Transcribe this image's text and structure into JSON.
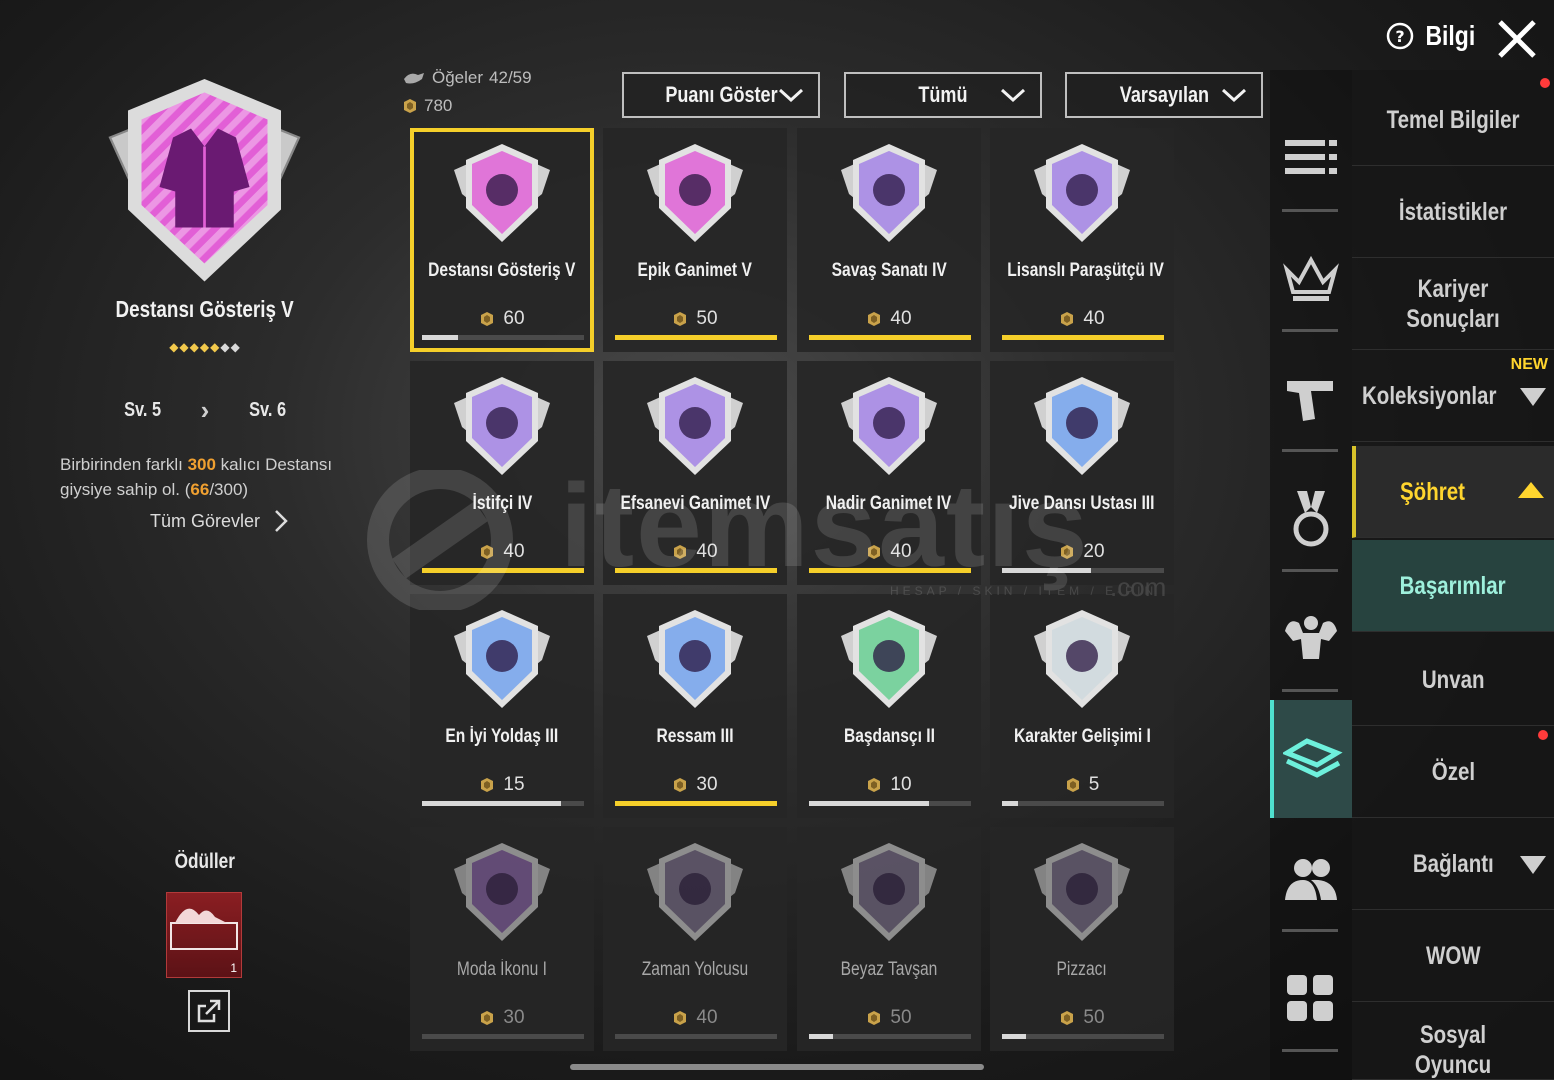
{
  "header": {
    "info_label": "Bilgi"
  },
  "selected": {
    "title": "Destansı Gösteriş V",
    "stars_filled": 5,
    "stars_total": 7,
    "level_from": "Sv. 5",
    "level_to": "Sv. 6",
    "desc_prefix": "Birbirinden farklı",
    "desc_target": "300",
    "desc_mid": "kalıcı Destansı giysiye sahip ol. (",
    "desc_progress": "66",
    "desc_suffix": "/300)",
    "all_tasks": "Tüm Görevler",
    "rewards_title": "Ödüller",
    "reward_count": "1"
  },
  "stats": {
    "items_label": "Öğeler",
    "items_value": "42/59",
    "points_value": "780"
  },
  "filters": {
    "points": "Puanı Göster",
    "category": "Tümü",
    "sort": "Varsayılan"
  },
  "achievements": [
    {
      "name": "Destansı Gösteriş V",
      "points": "60",
      "progress": 0.22,
      "color": "#d957d0",
      "selected": true,
      "locked": false,
      "complete": false
    },
    {
      "name": "Epik Ganimet V",
      "points": "50",
      "progress": 1.0,
      "color": "#d957d0",
      "selected": false,
      "locked": false,
      "complete": true
    },
    {
      "name": "Savaş Sanatı IV",
      "points": "40",
      "progress": 1.0,
      "color": "#9b7ae0",
      "selected": false,
      "locked": false,
      "complete": true
    },
    {
      "name": "Lisanslı Paraşütçü IV",
      "points": "40",
      "progress": 1.0,
      "color": "#9b7ae0",
      "selected": false,
      "locked": false,
      "complete": true
    },
    {
      "name": "İstifçi IV",
      "points": "40",
      "progress": 1.0,
      "color": "#9b7ae0",
      "selected": false,
      "locked": false,
      "complete": true
    },
    {
      "name": "Efsanevi Ganimet IV",
      "points": "40",
      "progress": 1.0,
      "color": "#9b7ae0",
      "selected": false,
      "locked": false,
      "complete": true
    },
    {
      "name": "Nadir Ganimet IV",
      "points": "40",
      "progress": 1.0,
      "color": "#9b7ae0",
      "selected": false,
      "locked": false,
      "complete": true
    },
    {
      "name": "Jive Dansı Ustası III",
      "points": "20",
      "progress": 0.55,
      "color": "#6b9be8",
      "selected": false,
      "locked": false,
      "complete": false
    },
    {
      "name": "En İyi Yoldaş III",
      "points": "15",
      "progress": 0.86,
      "color": "#6b9be8",
      "selected": false,
      "locked": false,
      "complete": false
    },
    {
      "name": "Ressam III",
      "points": "30",
      "progress": 1.0,
      "color": "#6b9be8",
      "selected": false,
      "locked": false,
      "complete": true
    },
    {
      "name": "Başdansçı II",
      "points": "10",
      "progress": 0.74,
      "color": "#5fc98a",
      "selected": false,
      "locked": false,
      "complete": false
    },
    {
      "name": "Karakter Gelişimi I",
      "points": "5",
      "progress": 0.1,
      "color": "#c9d4d8",
      "selected": false,
      "locked": false,
      "complete": false
    },
    {
      "name": "Moda İkonu I",
      "points": "30",
      "progress": 0.0,
      "color": "#7e4aa8",
      "selected": false,
      "locked": true,
      "complete": false
    },
    {
      "name": "Zaman Yolcusu",
      "points": "40",
      "progress": 0.0,
      "color": "#6b5a80",
      "selected": false,
      "locked": true,
      "complete": false
    },
    {
      "name": "Beyaz Tavşan",
      "points": "50",
      "progress": 0.15,
      "color": "#6b5a80",
      "selected": false,
      "locked": true,
      "complete": false
    },
    {
      "name": "Pizzacı",
      "points": "50",
      "progress": 0.15,
      "color": "#6b5a80",
      "selected": false,
      "locked": true,
      "complete": false
    }
  ],
  "menu": {
    "items": [
      {
        "label": "Temel Bilgiler",
        "dot": true
      },
      {
        "label": "İstatistikler",
        "dot": false
      },
      {
        "label": "Kariyer Sonuçları",
        "dot": false
      },
      {
        "label": "Koleksiyonlar",
        "dot": false
      },
      {
        "label": "Şöhret",
        "dot": false
      },
      {
        "label": "Başarımlar",
        "dot": false
      },
      {
        "label": "Unvan",
        "dot": false
      },
      {
        "label": "Özel",
        "dot": true
      },
      {
        "label": "Bağlantı",
        "dot": false
      },
      {
        "label": "WOW",
        "dot": false
      },
      {
        "label": "Sosyal Oyuncu Kartı",
        "dot": false
      }
    ],
    "new_tag": "NEW"
  },
  "watermark": {
    "brand": "itemsatış",
    "sub": "HESAP / SKIN / ITEM / E-PIN",
    "domain": ".com"
  },
  "colors": {
    "accent_yellow": "#f5cf2a",
    "teal_active": "#4fe0cf",
    "alert_red": "#ff3b3b"
  }
}
